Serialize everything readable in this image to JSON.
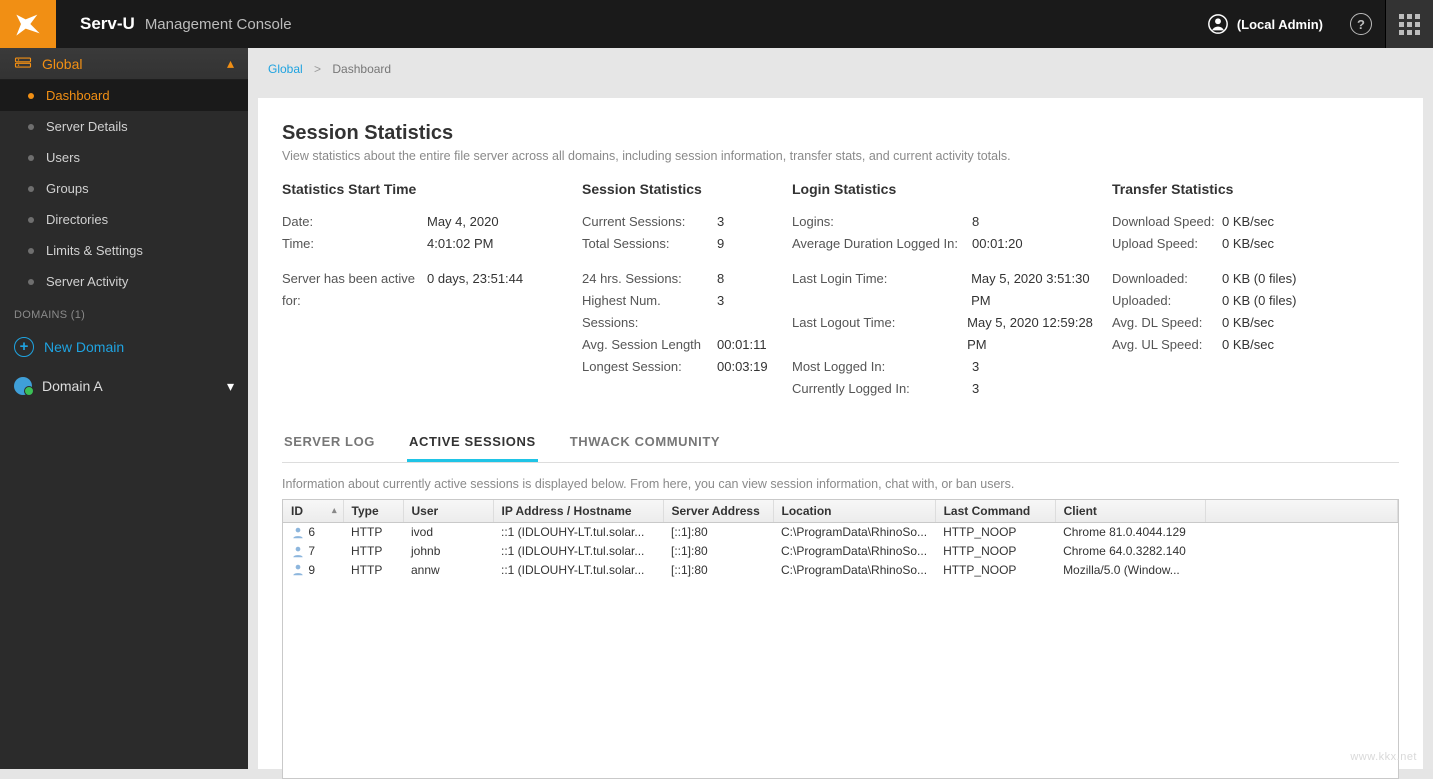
{
  "brand": {
    "main": "Serv-U",
    "sub": "Management Console"
  },
  "user": {
    "label": "(Local Admin)"
  },
  "sidebar": {
    "head": "Global",
    "items": [
      {
        "label": "Dashboard",
        "active": true
      },
      {
        "label": "Server Details"
      },
      {
        "label": "Users"
      },
      {
        "label": "Groups"
      },
      {
        "label": "Directories"
      },
      {
        "label": "Limits & Settings"
      },
      {
        "label": "Server Activity"
      }
    ],
    "domains_label": "DOMAINS (1)",
    "new_domain": "New Domain",
    "domain_a": "Domain A"
  },
  "crumb": {
    "a": "Global",
    "b": "Dashboard"
  },
  "page": {
    "title": "Session Statistics",
    "subtitle": "View statistics about the entire file server across all domains, including session information, transfer stats, and current activity totals."
  },
  "stats": {
    "col1": {
      "head": "Statistics Start Time",
      "kv": [
        {
          "k": "Date:",
          "v": "May 4, 2020"
        },
        {
          "k": "Time:",
          "v": "4:01:02 PM"
        }
      ],
      "kv2": [
        {
          "k": "Server has been active for:",
          "v": "0 days, 23:51:44"
        }
      ]
    },
    "col2": {
      "head": "Session Statistics",
      "kv": [
        {
          "k": "Current Sessions:",
          "v": "3"
        },
        {
          "k": "Total Sessions:",
          "v": "9"
        }
      ],
      "kv2": [
        {
          "k": "24 hrs. Sessions:",
          "v": "8"
        },
        {
          "k": "Highest Num. Sessions:",
          "v": "3"
        },
        {
          "k": "Avg. Session Length",
          "v": "00:01:11"
        },
        {
          "k": "Longest Session:",
          "v": "00:03:19"
        }
      ]
    },
    "col3": {
      "head": "Login Statistics",
      "kv": [
        {
          "k": "Logins:",
          "v": "8"
        },
        {
          "k": "Average Duration Logged In:",
          "v": "00:01:20"
        }
      ],
      "kv2": [
        {
          "k": "Last Login Time:",
          "v": "May 5, 2020 3:51:30 PM"
        },
        {
          "k": "Last Logout Time:",
          "v": "May 5, 2020 12:59:28 PM"
        },
        {
          "k": "Most Logged In:",
          "v": "3"
        },
        {
          "k": "Currently Logged In:",
          "v": "3"
        }
      ]
    },
    "col4": {
      "head": "Transfer Statistics",
      "kv": [
        {
          "k": "Download Speed:",
          "v": "0 KB/sec"
        },
        {
          "k": "Upload Speed:",
          "v": "0 KB/sec"
        }
      ],
      "kv2": [
        {
          "k": "Downloaded:",
          "v": "0 KB (0 files)"
        },
        {
          "k": "Uploaded:",
          "v": "0 KB (0 files)"
        },
        {
          "k": "Avg. DL Speed:",
          "v": "0 KB/sec"
        },
        {
          "k": "Avg. UL Speed:",
          "v": "0 KB/sec"
        }
      ]
    }
  },
  "tabs": {
    "server_log": "SERVER LOG",
    "active_sessions": "ACTIVE SESSIONS",
    "thwack": "THWACK COMMUNITY"
  },
  "active_desc": "Information about currently active sessions is displayed below. From here, you can view session information, chat with, or ban users.",
  "table": {
    "headers": [
      "ID",
      "Type",
      "User",
      "IP Address / Hostname",
      "Server Address",
      "Location",
      "Last Command",
      "Client",
      ""
    ],
    "rows": [
      {
        "id": "6",
        "type": "HTTP",
        "user": "ivod",
        "ip": "::1 (IDLOUHY-LT.tul.solar...",
        "server": "[::1]:80",
        "loc": "C:\\ProgramData\\RhinoSo...",
        "cmd": "HTTP_NOOP",
        "client": "Chrome 81.0.4044.129"
      },
      {
        "id": "7",
        "type": "HTTP",
        "user": "johnb",
        "ip": "::1 (IDLOUHY-LT.tul.solar...",
        "server": "[::1]:80",
        "loc": "C:\\ProgramData\\RhinoSo...",
        "cmd": "HTTP_NOOP",
        "client": "Chrome 64.0.3282.140"
      },
      {
        "id": "9",
        "type": "HTTP",
        "user": "annw",
        "ip": "::1 (IDLOUHY-LT.tul.solar...",
        "server": "[::1]:80",
        "loc": "C:\\ProgramData\\RhinoSo...",
        "cmd": "HTTP_NOOP",
        "client": "Mozilla/5.0 (Window..."
      }
    ]
  },
  "watermark": "www.kkx.net"
}
